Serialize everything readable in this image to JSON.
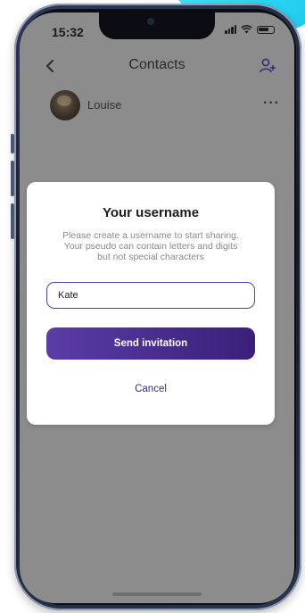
{
  "status_bar": {
    "time": "15:32"
  },
  "header": {
    "title": "Contacts"
  },
  "contacts": [
    {
      "name": "Louise",
      "more": "···"
    }
  ],
  "modal": {
    "title": "Your username",
    "description_lines": [
      "Please create a username to start sharing.",
      "Your pseudo can contain letters and digits",
      "but not special characters"
    ],
    "input_value": "Kate",
    "send_label": "Send invitation",
    "cancel_label": "Cancel"
  },
  "colors": {
    "accent": "#4a2e92",
    "overlay": "#8c8c8c",
    "cyan": "#2fd8f2"
  },
  "icons": [
    "back-icon",
    "add-contact-icon",
    "more-icon",
    "signal-icon",
    "wifi-icon",
    "battery-icon"
  ]
}
